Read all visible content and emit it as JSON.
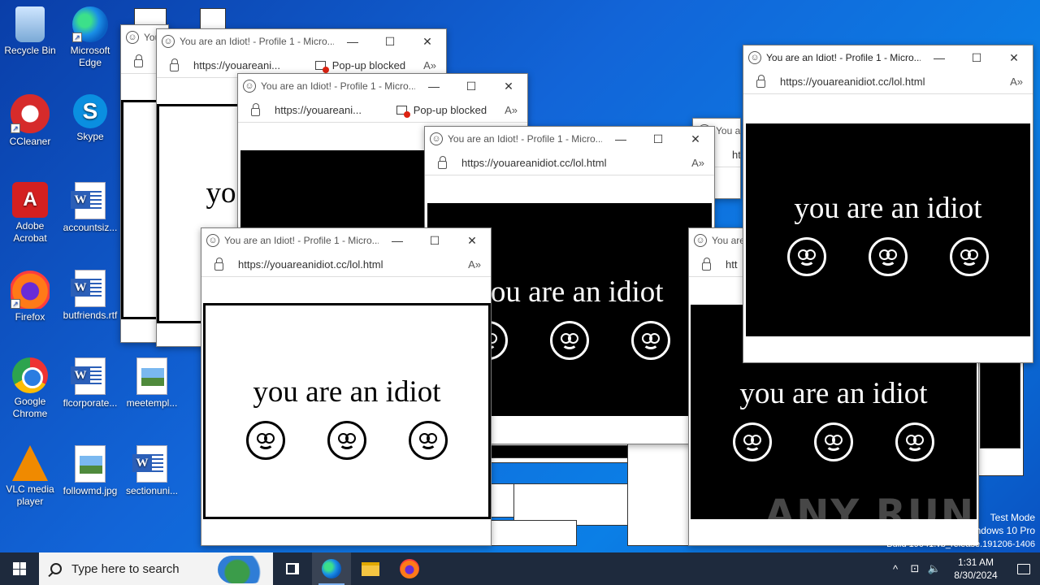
{
  "desktop": {
    "icons": [
      {
        "label": "Recycle Bin",
        "symbol": "recycle-bin-icon"
      },
      {
        "label": "Microsoft Edge",
        "symbol": "edge-icon"
      },
      {
        "label": "CCleaner",
        "symbol": "ccleaner-icon"
      },
      {
        "label": "Skype",
        "symbol": "skype-icon",
        "glyph": "S"
      },
      {
        "label": "Adobe Acrobat",
        "symbol": "acrobat-icon",
        "glyph": "A"
      },
      {
        "label": "accountsiz...",
        "symbol": "word-document-icon"
      },
      {
        "label": "Firefox",
        "symbol": "firefox-icon"
      },
      {
        "label": "butfriends.rtf",
        "symbol": "word-document-icon"
      },
      {
        "label": "Google Chrome",
        "symbol": "chrome-icon"
      },
      {
        "label": "flcorporate...",
        "symbol": "word-document-icon"
      },
      {
        "label": "meetempl...",
        "symbol": "image-file-icon"
      },
      {
        "label": "VLC media player",
        "symbol": "vlc-icon"
      },
      {
        "label": "followmd.jpg",
        "symbol": "image-file-icon"
      },
      {
        "label": "sectionuni...",
        "symbol": "word-document-icon"
      }
    ]
  },
  "windows": [
    {
      "title": "You",
      "url": "",
      "popup_blocked": false
    },
    {
      "title": "You are an Idiot! - Profile 1 - Micro...",
      "url": "https://youareani...",
      "popup_blocked": true
    },
    {
      "title": "You are an Idiot! - Profile 1 - Micro...",
      "url": "https://youareani...",
      "popup_blocked": true
    },
    {
      "title": "You are an Idiot! - Profile 1 - Micro...",
      "url": "https://youareanidiot.cc/lol.html",
      "popup_blocked": false,
      "text": "you are an idiot"
    },
    {
      "title": "You are an Idiot! - Profile 1 - Micro...",
      "url": "https://youareanidiot.cc/lol.html",
      "popup_blocked": false,
      "text": "you are an idiot"
    },
    {
      "title": "You are",
      "url": "htt",
      "popup_blocked": false,
      "text": "you are an idiot"
    },
    {
      "title": "You are an Idiot! - Profile 1 - Micro...",
      "url": "https://youareanidiot.cc/lol.html",
      "popup_blocked": false,
      "text": "you are an idiot"
    }
  ],
  "partial_text": {
    "left_window": "yo",
    "small_title": "You are",
    "small_url": "htt"
  },
  "popup_blocked_label": "Pop-up blocked",
  "controls": {
    "minimize": "—",
    "maximize": "☐",
    "close": "✕",
    "smiley": "☺",
    "read_aloud": "A»"
  },
  "watermark": "ANY RUN",
  "os_info": {
    "line1": "Test Mode",
    "line2": "Windows 10 Pro",
    "line3": "Build 19041.vb_release.191206-1406"
  },
  "taskbar": {
    "search_placeholder": "Type here to search",
    "time": "1:31 AM",
    "date": "8/30/2024",
    "tray": {
      "chevron": "^",
      "network": "⊡",
      "volume": "🔈"
    }
  },
  "colors": {
    "accent": "#0a5fc2",
    "taskbar": "#1e2a3d"
  }
}
